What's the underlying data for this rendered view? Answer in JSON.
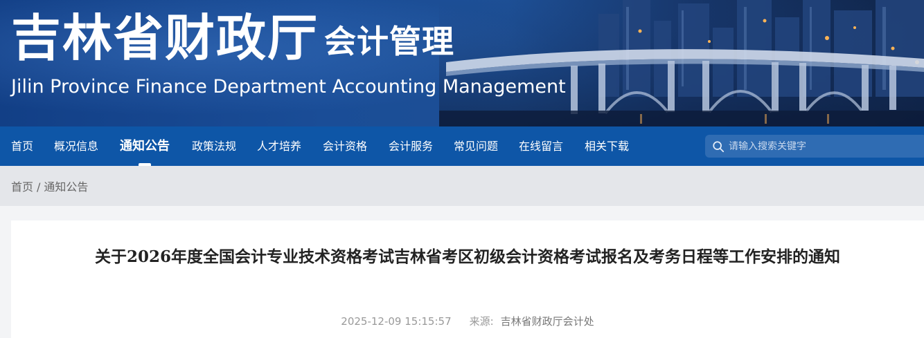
{
  "header": {
    "title_cn": "吉林省财政厅",
    "subtitle_cn": "会计管理",
    "title_en": "Jilin Province Finance Department Accounting Management"
  },
  "nav": {
    "items": [
      {
        "label": "首页",
        "active": false
      },
      {
        "label": "概况信息",
        "active": false
      },
      {
        "label": "通知公告",
        "active": true
      },
      {
        "label": "政策法规",
        "active": false
      },
      {
        "label": "人才培养",
        "active": false
      },
      {
        "label": "会计资格",
        "active": false
      },
      {
        "label": "会计服务",
        "active": false
      },
      {
        "label": "常见问题",
        "active": false
      },
      {
        "label": "在线留言",
        "active": false
      },
      {
        "label": "相关下载",
        "active": false
      }
    ],
    "search_placeholder": "请输入搜索关键字"
  },
  "breadcrumb": {
    "home": "首页",
    "separator": "/",
    "current": "通知公告"
  },
  "article": {
    "title": "关于2026年度全国会计专业技术资格考试吉林省考区初级会计资格考试报名及考务日程等工作安排的通知",
    "datetime": "2025-12-09 15:15:57",
    "source_label": "来源:",
    "source_value": "吉林省财政厅会计处"
  },
  "colors": {
    "nav_bg": "#0e56a7",
    "banner_blue": "#1a4d97",
    "breadcrumb_bg": "#e4e6ea"
  }
}
